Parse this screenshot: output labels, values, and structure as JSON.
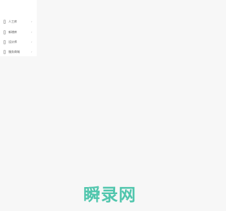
{
  "sidebar": {
    "items": [
      {
        "icon": "phone-icon",
        "label": "人工库",
        "arrow": "›"
      },
      {
        "icon": "phone-icon",
        "label": "新增库",
        "arrow": "›"
      },
      {
        "icon": "phone-icon",
        "label": "设计师",
        "arrow": "›"
      },
      {
        "icon": "phone-icon",
        "label": "服务商城",
        "arrow": "›"
      }
    ]
  },
  "watermark": {
    "text": "瞬录网"
  },
  "colors": {
    "background": "#f7f7f7",
    "sidebar": "#ffffff",
    "watermark": "#3ec1a5"
  }
}
